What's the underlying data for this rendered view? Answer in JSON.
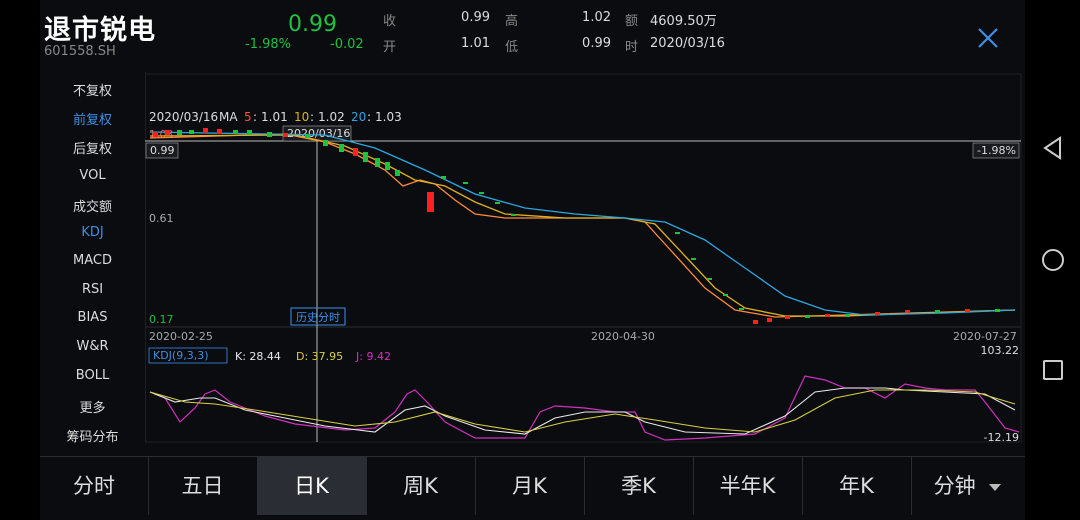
{
  "header": {
    "name": "退市锐电",
    "code": "601558.SH",
    "price": "0.99",
    "change_pct": "-1.98%",
    "change": "-0.02",
    "quotes": [
      {
        "label": "收",
        "value": "0.99"
      },
      {
        "label": "开",
        "value": "1.01"
      },
      {
        "label": "高",
        "value": "1.02"
      },
      {
        "label": "低",
        "value": "0.99"
      },
      {
        "label": "额",
        "value": "4609.50万"
      },
      {
        "label": "时",
        "value": "2020/03/16"
      }
    ]
  },
  "menu": [
    "不复权",
    "前复权",
    "后复权",
    "VOL",
    "成交额",
    "KDJ",
    "MACD",
    "RSI",
    "BIAS",
    "W&R",
    "BOLL",
    "更多",
    "筹码分布"
  ],
  "menu_active": [
    "前复权",
    "KDJ"
  ],
  "chart": {
    "ma_line": {
      "date": "2020/03/16",
      "ma_label": "MA",
      "ma5_label": "5",
      "ma5": "1.01",
      "ma10_label": "10",
      "ma10": "1.02",
      "ma20_label": "20",
      "ma20": "1.03"
    },
    "cursor_date": "2020/03/16",
    "price_tag_left": "0.99",
    "price_tag_right": "-1.98%",
    "y_mid": "0.61",
    "y_low": "0.17",
    "y_top_partial": "1.03",
    "history_btn": "历史分时",
    "x_dates": [
      "2020-02-25",
      "2020-04-30",
      "2020-07-27"
    ],
    "kdj": {
      "label": "KDJ(9,3,3)",
      "k": "K: 28.44",
      "d": "D: 37.95",
      "j": "J: 9.42",
      "max": "103.22",
      "min": "-12.19"
    }
  },
  "colors": {
    "up": "#ff2020",
    "down": "#20c040",
    "ma5": "#ff8a3d",
    "ma10": "#e0b020",
    "ma20": "#2aa8e0",
    "accent": "#3d8fe6",
    "kdj_k": "#e8e8e8",
    "kdj_d": "#d8d040",
    "kdj_j": "#d030c0"
  },
  "tabs": [
    "分时",
    "五日",
    "日K",
    "周K",
    "月K",
    "季K",
    "半年K",
    "年K",
    "分钟"
  ],
  "tab_active": "日K",
  "icons": {
    "close": "close-icon",
    "dropdown": "caret-down-icon",
    "back": "back-triangle-icon",
    "home": "home-circle-icon",
    "recents": "recents-square-icon"
  }
}
